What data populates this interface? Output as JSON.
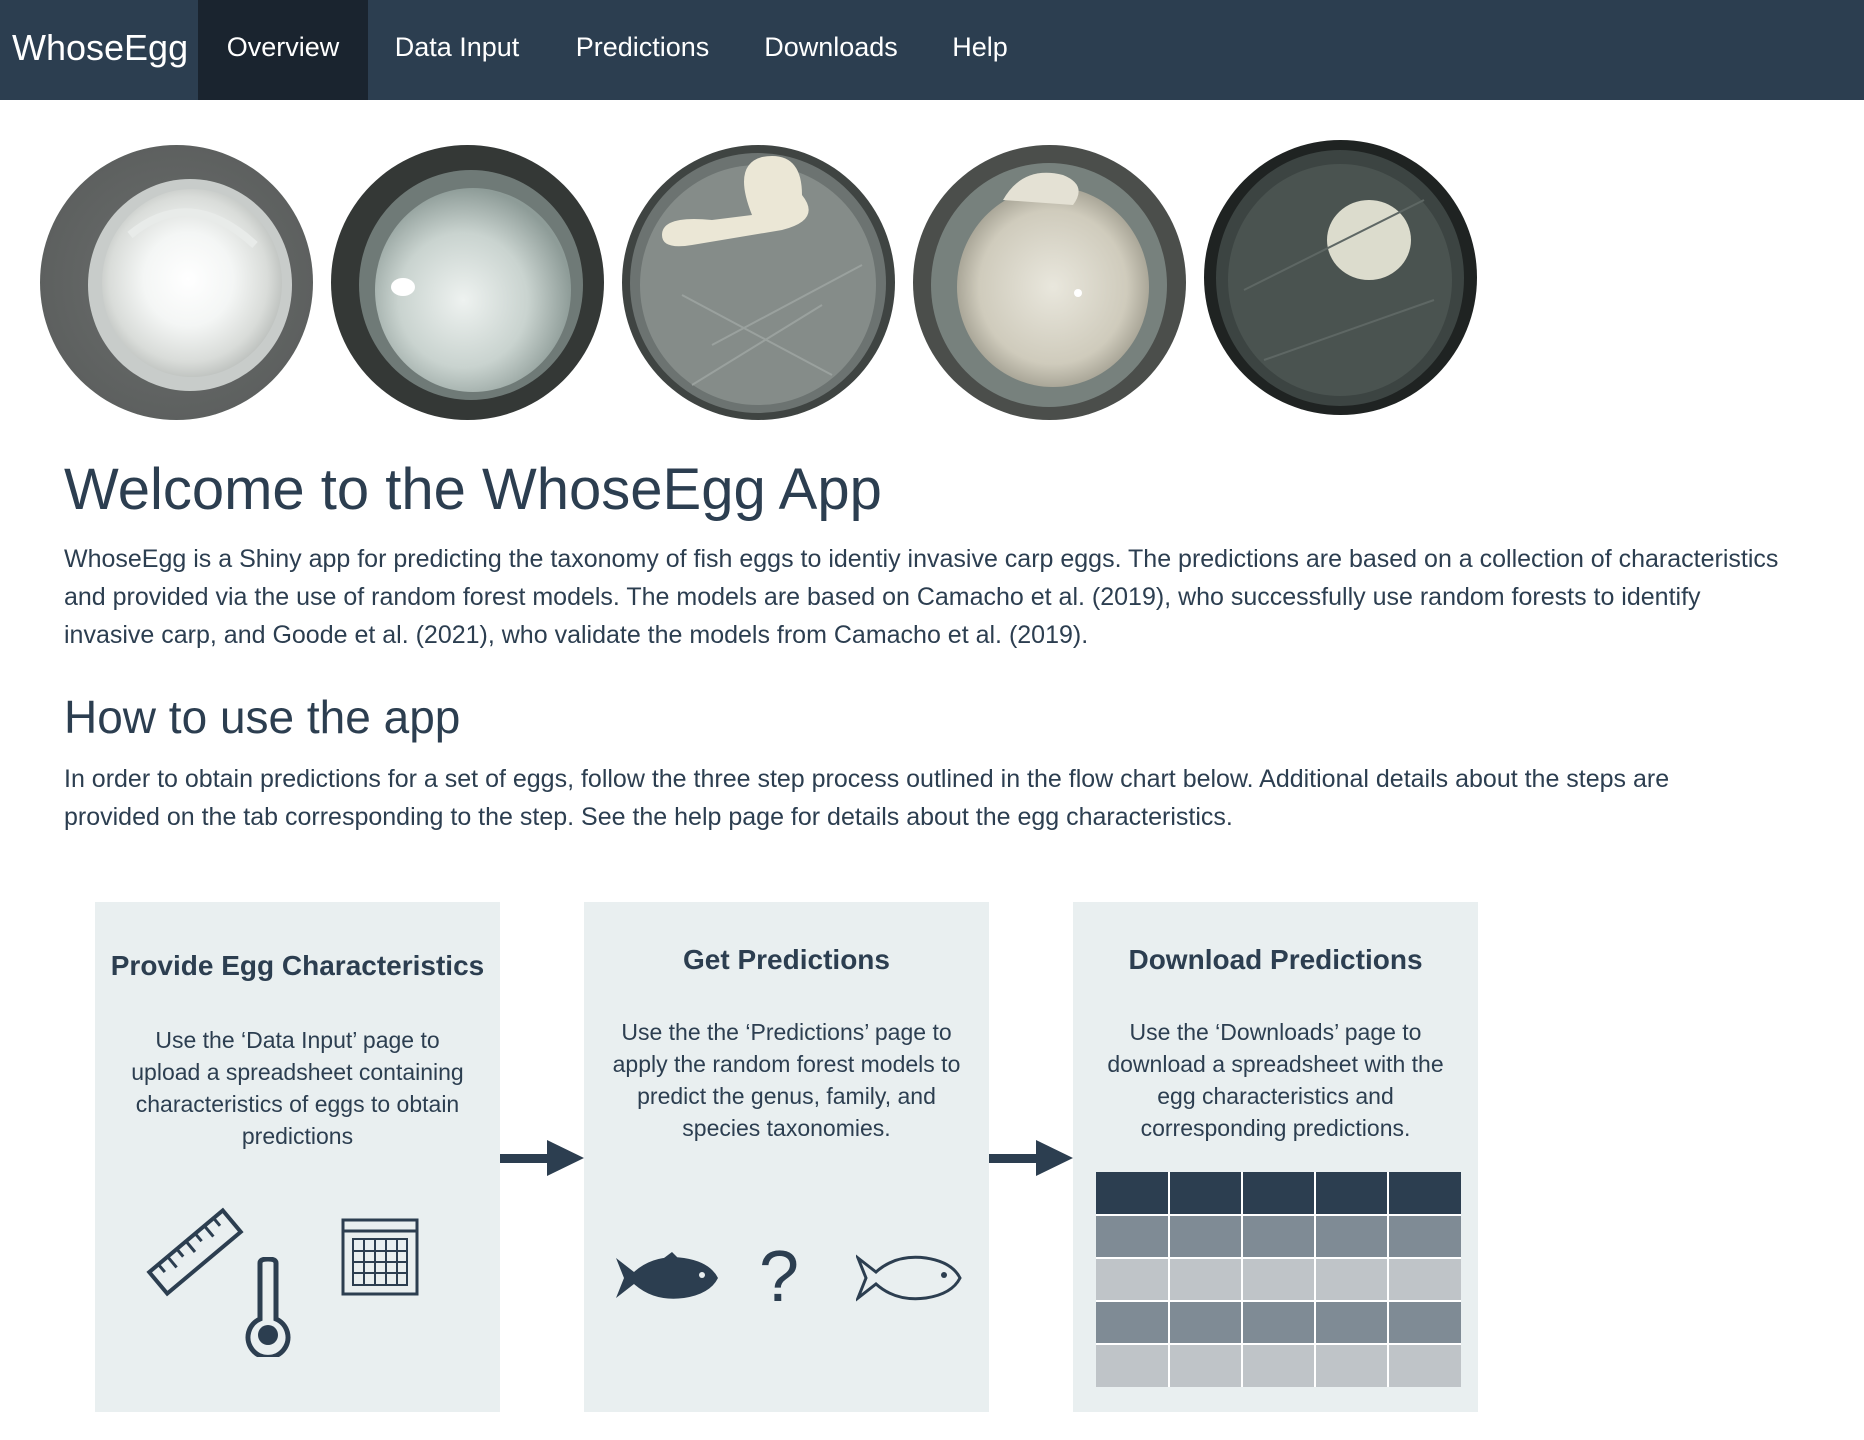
{
  "app": {
    "brand": "WhoseEgg"
  },
  "nav": {
    "items": [
      {
        "label": "Overview",
        "active": true
      },
      {
        "label": "Data Input",
        "active": false
      },
      {
        "label": "Predictions",
        "active": false
      },
      {
        "label": "Downloads",
        "active": false
      },
      {
        "label": "Help",
        "active": false
      }
    ]
  },
  "main": {
    "welcome_title": "Welcome to the WhoseEgg App",
    "intro_lines": [
      "WhoseEgg is a Shiny app for predicting the taxonomy of fish eggs to identiy invasive carp eggs. The predictions are based on a collection of characteristics",
      "and provided via the use of random forest models. The models are based on Camacho et al. (2019), who successfully use random forests to identify",
      "invasive carp, and Goode et al. (2021), who validate the models from Camacho et al. (2019)."
    ],
    "howto_title": "How to use the app",
    "howto_lines": [
      "In order to obtain predictions for a set of eggs, follow the three step process outlined in the flow chart below. Additional details about the steps are",
      "provided on the tab corresponding to the step. See the help page for details about the egg characteristics."
    ]
  },
  "flow": {
    "steps": [
      {
        "title": "Provide Egg Characteristics",
        "lines": [
          "Use the ‘Data Input’ page to",
          "upload a spreadsheet containing",
          "characteristics of eggs to obtain",
          "predictions"
        ],
        "icons": [
          "ruler-icon",
          "thermometer-icon",
          "calendar-icon"
        ]
      },
      {
        "title": "Get Predictions",
        "lines": [
          "Use the the ‘Predictions’ page to",
          "apply the random forest models to",
          "predict the genus, family, and",
          "species taxonomies."
        ],
        "icons": [
          "fish-icon",
          "question-mark-icon",
          "fish-outline-icon"
        ],
        "question_glyph": "?"
      },
      {
        "title": "Download Predictions",
        "lines": [
          "Use the ‘Downloads’ page to",
          "download a spreadsheet with the",
          "egg characteristics and",
          "corresponding predictions."
        ],
        "icons": [
          "spreadsheet-table-icon"
        ]
      }
    ]
  },
  "colors": {
    "navbar": "#2c3e50",
    "navbar_active": "#1a242f",
    "text": "#2c3e50",
    "step_box": "#e9eff0",
    "table_header": "#2c3e50",
    "table_dark": "#7f8b95",
    "table_light": "#bfc4c8"
  }
}
